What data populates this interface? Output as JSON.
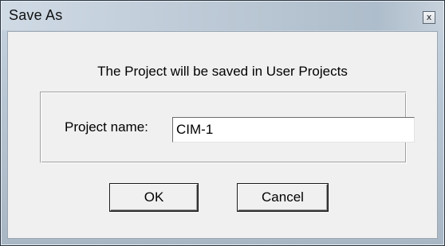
{
  "window": {
    "title": "Save As",
    "close_glyph": "x"
  },
  "dialog": {
    "info_text": "The Project will be saved in User Projects",
    "project_name_label": "Project name:",
    "project_name_value": "CIM-1",
    "ok_label": "OK",
    "cancel_label": "Cancel"
  }
}
